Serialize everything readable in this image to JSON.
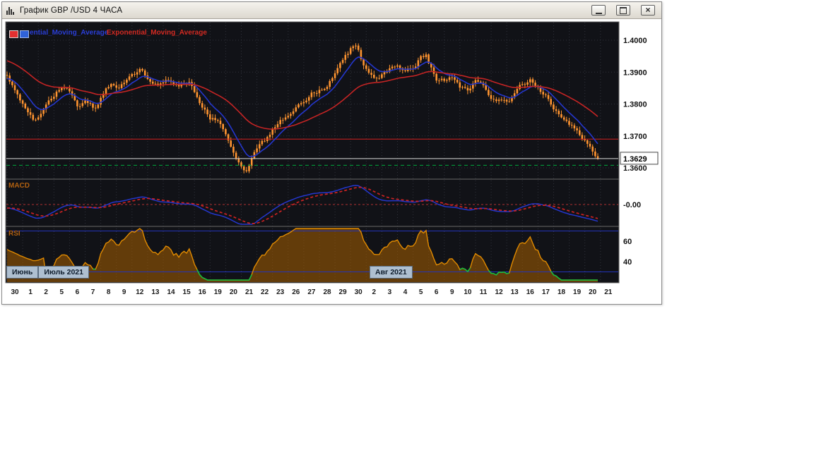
{
  "window": {
    "title": "График GBP /USD  4 ЧАСА",
    "controls": {
      "close_glyph": "×",
      "minimize_icon": "minimize-icon",
      "restore_icon": "restore-icon",
      "close_icon": "close-icon"
    }
  },
  "legend": {
    "ema_fast_label": "ential_Moving_Average",
    "ema_slow_label": "Exponential_Moving_Average"
  },
  "panels": {
    "macd_label": "MACD",
    "rsi_label": "RSI"
  },
  "axis": {
    "price_ticks": [
      "1.4000",
      "1.3900",
      "1.3800",
      "1.3700",
      "1.3600"
    ],
    "current_price": "1.3629",
    "macd_tick": "-0.00",
    "rsi_ticks": [
      "60",
      "40"
    ],
    "dates": [
      "30",
      "1",
      "2",
      "5",
      "6",
      "7",
      "8",
      "9",
      "12",
      "13",
      "14",
      "15",
      "16",
      "19",
      "20",
      "21",
      "22",
      "23",
      "26",
      "27",
      "28",
      "29",
      "30",
      "2",
      "3",
      "4",
      "5",
      "6",
      "9",
      "10",
      "11",
      "12",
      "13",
      "16",
      "17",
      "18",
      "19",
      "20",
      "21"
    ],
    "months": [
      {
        "label": "Июнь",
        "day_index": 0
      },
      {
        "label": "Июль 2021",
        "day_index": 1
      },
      {
        "label": "Авг 2021",
        "day_index": 23
      }
    ]
  },
  "levels": {
    "resistance_red": 1.369,
    "current_price_value": 1.3629,
    "support_green": 1.3608,
    "rsi_upper": 70,
    "rsi_lower": 30,
    "rsi_tick_values": [
      60,
      40
    ]
  },
  "colors": {
    "plot_bg": "#111217",
    "grid": "#30323b",
    "candle": "#ff9430",
    "ema_fast": "#2436cc",
    "ema_slow": "#c42424",
    "level_red": "#d42020",
    "level_white": "#dcdcdc",
    "level_green": "#00a83c",
    "macd_line": "#2436cc",
    "macd_signal": "#cc2222",
    "macd_zero": "#b03030",
    "rsi_line": "#e08a00",
    "rsi_fill": "rgba(168,94,0,0.55)",
    "rsi_green": "#10c040",
    "rsi_level": "#2233bb",
    "axis_text": "#111111"
  },
  "chart_data": {
    "type": "candlestick+indicators",
    "symbol": "GBP/USD",
    "timeframe": "4 ЧАСА",
    "title": "График GBP /USD  4 ЧАСА",
    "series": [
      {
        "name": "Candles GBP/USD",
        "type": "candlestick"
      },
      {
        "name": "Exponential_Moving_Average (fast, blue)",
        "type": "line"
      },
      {
        "name": "Exponential_Moving_Average (slow, red)",
        "type": "line"
      },
      {
        "name": "MACD",
        "type": "line"
      },
      {
        "name": "RSI",
        "type": "line"
      }
    ],
    "price_anchors": [
      [
        0,
        1.3885
      ],
      [
        3,
        1.3845
      ],
      [
        6,
        1.3805
      ],
      [
        9,
        1.376
      ],
      [
        11,
        1.3748
      ],
      [
        13,
        1.3772
      ],
      [
        18,
        1.3828
      ],
      [
        21,
        1.3858
      ],
      [
        24,
        1.3842
      ],
      [
        27,
        1.38
      ],
      [
        30,
        1.3806
      ],
      [
        34,
        1.3788
      ],
      [
        36,
        1.3818
      ],
      [
        40,
        1.3866
      ],
      [
        42,
        1.3846
      ],
      [
        46,
        1.3876
      ],
      [
        48,
        1.389
      ],
      [
        51,
        1.3906
      ],
      [
        54,
        1.3884
      ],
      [
        58,
        1.3854
      ],
      [
        62,
        1.3876
      ],
      [
        66,
        1.3858
      ],
      [
        70,
        1.3864
      ],
      [
        72,
        1.3836
      ],
      [
        75,
        1.3794
      ],
      [
        78,
        1.3756
      ],
      [
        81,
        1.3744
      ],
      [
        84,
        1.3698
      ],
      [
        87,
        1.3648
      ],
      [
        90,
        1.3602
      ],
      [
        92,
        1.359
      ],
      [
        94,
        1.3635
      ],
      [
        96,
        1.3668
      ],
      [
        99,
        1.3686
      ],
      [
        102,
        1.3718
      ],
      [
        105,
        1.3742
      ],
      [
        108,
        1.3762
      ],
      [
        111,
        1.3784
      ],
      [
        114,
        1.3804
      ],
      [
        117,
        1.3836
      ],
      [
        120,
        1.3843
      ],
      [
        123,
        1.3862
      ],
      [
        126,
        1.3896
      ],
      [
        129,
        1.3938
      ],
      [
        132,
        1.3972
      ],
      [
        134,
        1.3986
      ],
      [
        136,
        1.3944
      ],
      [
        138,
        1.3912
      ],
      [
        141,
        1.388
      ],
      [
        144,
        1.389
      ],
      [
        147,
        1.391
      ],
      [
        150,
        1.3928
      ],
      [
        153,
        1.3908
      ],
      [
        156,
        1.3912
      ],
      [
        159,
        1.3948
      ],
      [
        161,
        1.3952
      ],
      [
        163,
        1.3912
      ],
      [
        165,
        1.3876
      ],
      [
        168,
        1.3878
      ],
      [
        171,
        1.389
      ],
      [
        174,
        1.3856
      ],
      [
        177,
        1.3846
      ],
      [
        180,
        1.3868
      ],
      [
        183,
        1.3856
      ],
      [
        186,
        1.3822
      ],
      [
        189,
        1.381
      ],
      [
        192,
        1.3804
      ],
      [
        195,
        1.383
      ],
      [
        198,
        1.3866
      ],
      [
        201,
        1.3874
      ],
      [
        204,
        1.3854
      ],
      [
        207,
        1.3824
      ],
      [
        210,
        1.379
      ],
      [
        213,
        1.3766
      ],
      [
        216,
        1.3742
      ],
      [
        219,
        1.3716
      ],
      [
        222,
        1.3686
      ],
      [
        224,
        1.366
      ],
      [
        226,
        1.364
      ],
      [
        227,
        1.3629
      ]
    ],
    "layout": {
      "candle_count": 228,
      "candles_per_day": 6,
      "day_count": 38,
      "price_axis_range": [
        1.3571,
        1.4058
      ],
      "price_gridlines": [
        1.4,
        1.39,
        1.38,
        1.37,
        1.36
      ],
      "rsi_levels": [
        70,
        30
      ],
      "macd_zero": 0,
      "ema_fast_period": 10,
      "ema_slow_period": 40,
      "macd_fast": 12,
      "macd_slow": 26,
      "macd_signal": 9,
      "rsi_period": 14,
      "grid": true,
      "legend_position": "top-left"
    }
  }
}
